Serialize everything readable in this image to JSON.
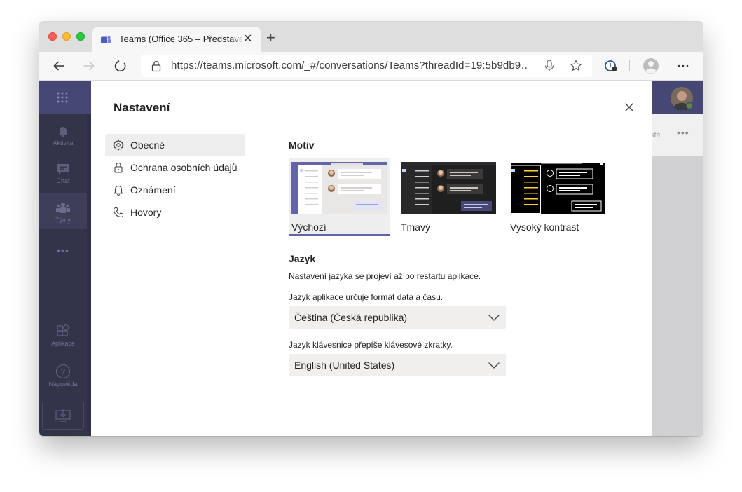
{
  "browser": {
    "tab_title": "Teams (Office 365 – Představe",
    "url": "https://teams.microsoft.com/_#/conversations/Teams?threadId=19:5b9db9…"
  },
  "rail": {
    "items": [
      {
        "label": "Aktivita",
        "icon": "bell-icon"
      },
      {
        "label": "Chat",
        "icon": "chat-icon"
      },
      {
        "label": "Týmy",
        "icon": "teams-icon"
      },
      {
        "label": "Aplikace",
        "icon": "apps-icon"
      },
      {
        "label": "Nápověda",
        "icon": "help-icon"
      }
    ]
  },
  "background": {
    "partial_text": "sté"
  },
  "modal": {
    "title": "Nastavení",
    "nav": [
      {
        "label": "Obecné",
        "icon": "gear-icon",
        "active": true
      },
      {
        "label": "Ochrana osobních údajů",
        "icon": "lock-icon",
        "active": false
      },
      {
        "label": "Oznámení",
        "icon": "bell-icon",
        "active": false
      },
      {
        "label": "Hovory",
        "icon": "phone-icon",
        "active": false
      }
    ],
    "theme": {
      "heading": "Motiv",
      "options": [
        {
          "label": "Výchozí",
          "selected": true
        },
        {
          "label": "Tmavý",
          "selected": false
        },
        {
          "label": "Vysoký kontrast",
          "selected": false
        }
      ]
    },
    "language": {
      "heading": "Jazyk",
      "note": "Nastavení jazyka se projeví až po restartu aplikace.",
      "app_label": "Jazyk aplikace určuje formát data a času.",
      "app_value": "Čeština (Česká republika)",
      "keyboard_label": "Jazyk klávesnice přepíše klávesové zkratky.",
      "keyboard_value": "English (United States)"
    }
  },
  "colors": {
    "accent": "#6264a7",
    "rail": "#33344a",
    "topbar": "#464775"
  }
}
